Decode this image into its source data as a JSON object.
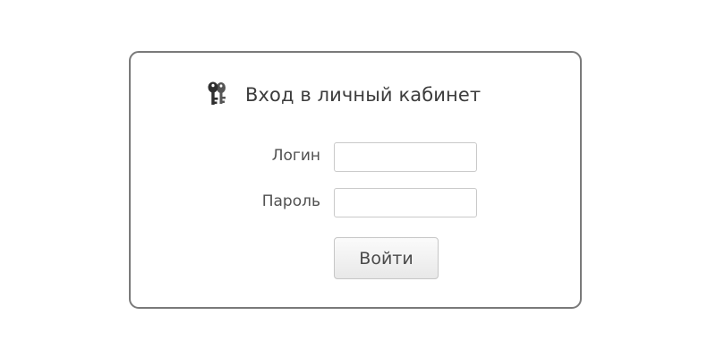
{
  "login_panel": {
    "icon": "keys-icon",
    "title": "Вход в личный кабинет",
    "login_label": "Логин",
    "login_value": "",
    "password_label": "Пароль",
    "password_value": "",
    "submit_label": "Войти"
  },
  "colors": {
    "panel_border": "#7a7a7a",
    "text": "#444444",
    "input_border": "#c9c9c9"
  }
}
